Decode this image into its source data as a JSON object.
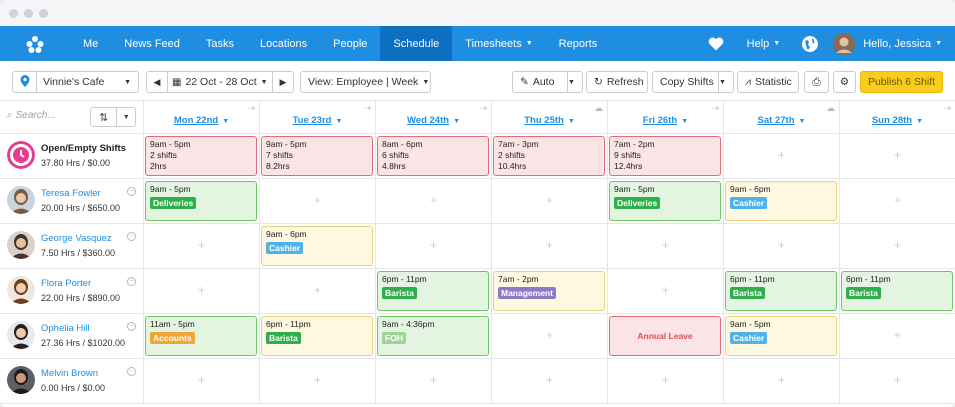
{
  "nav": {
    "items": [
      "Me",
      "News Feed",
      "Tasks",
      "Locations",
      "People",
      "Schedule",
      "Timesheets",
      "Reports"
    ],
    "active": "Schedule",
    "help": "Help",
    "greeting": "Hello, Jessica"
  },
  "toolbar": {
    "location": "Vinnie's Cafe",
    "date_range": "22 Oct - 28 Oct",
    "view": "View: Employee | Week",
    "auto": "Auto",
    "refresh": "Refresh",
    "copy_shifts": "Copy Shifts",
    "statistic": "Statistic",
    "publish": "Publish 6 Shift"
  },
  "grid": {
    "search_placeholder": "Search...",
    "days": [
      "Mon 22nd",
      "Tue 23rd",
      "Wed 24th",
      "Thu 25th",
      "Fri 26th",
      "Sat 27th",
      "Sun 28th"
    ],
    "rows": [
      {
        "name": "Open/Empty Shifts",
        "hours": "37.80 Hrs / $0.00",
        "cells": [
          {
            "lines": [
              "9am - 5pm",
              "2 shifts",
              "2hrs"
            ],
            "color": "red"
          },
          {
            "lines": [
              "9am - 5pm",
              "7 shifts",
              "8.2hrs"
            ],
            "color": "red"
          },
          {
            "lines": [
              "8am - 6pm",
              "6 shifts",
              "4.8hrs"
            ],
            "color": "red"
          },
          {
            "lines": [
              "7am - 3pm",
              "2 shifts",
              "10.4hrs"
            ],
            "color": "red"
          },
          {
            "lines": [
              "7am - 2pm",
              "9 shifts",
              "12.4hrs"
            ],
            "color": "red"
          },
          null,
          null
        ]
      },
      {
        "name": "Teresa Fowler",
        "hours": "20.00 Hrs / $650.00",
        "cells": [
          {
            "lines": [
              "9am - 5pm"
            ],
            "tag": "Deliveries",
            "tag_color": "#2eaf4a",
            "color": "green"
          },
          null,
          null,
          null,
          {
            "lines": [
              "9am - 5pm"
            ],
            "tag": "Deliveries",
            "tag_color": "#2eaf4a",
            "color": "green"
          },
          {
            "lines": [
              "9am - 6pm"
            ],
            "tag": "Cashier",
            "tag_color": "#4fb3e8",
            "color": "yellow"
          },
          null
        ]
      },
      {
        "name": "George Vasquez",
        "hours": "7.50 Hrs / $360.00",
        "cells": [
          null,
          {
            "lines": [
              "9am - 6pm"
            ],
            "tag": "Cashier",
            "tag_color": "#4fb3e8",
            "color": "yellow"
          },
          null,
          null,
          null,
          null,
          null
        ]
      },
      {
        "name": "Flora Porter",
        "hours": "22.00 Hrs / $890.00",
        "cells": [
          null,
          null,
          {
            "lines": [
              "6pm - 11pm"
            ],
            "tag": "Barista",
            "tag_color": "#2eaf4a",
            "color": "green"
          },
          {
            "lines": [
              "7am - 2pm"
            ],
            "tag": "Management",
            "tag_color": "#8c7bc6",
            "color": "yellow"
          },
          null,
          {
            "lines": [
              "6pm - 11pm"
            ],
            "tag": "Barista",
            "tag_color": "#2eaf4a",
            "color": "green"
          },
          {
            "lines": [
              "6pm - 11pm"
            ],
            "tag": "Barista",
            "tag_color": "#2eaf4a",
            "color": "green"
          }
        ]
      },
      {
        "name": "Ophelia Hill",
        "hours": "27.36 Hrs / $1020.00",
        "cells": [
          {
            "lines": [
              "11am - 5pm"
            ],
            "tag": "Accounts",
            "tag_color": "#f3a533",
            "color": "green"
          },
          {
            "lines": [
              "6pm - 11pm"
            ],
            "tag": "Barista",
            "tag_color": "#2eaf4a",
            "color": "yellow"
          },
          {
            "lines": [
              "9am - 4:36pm"
            ],
            "tag": "FOH",
            "tag_color": "#9fd39a",
            "color": "green"
          },
          null,
          {
            "leave": "Annual Leave"
          },
          {
            "lines": [
              "9am - 5pm"
            ],
            "tag": "Cashier",
            "tag_color": "#4fb3e8",
            "color": "yellow"
          },
          null
        ]
      },
      {
        "name": "Melvin Brown",
        "hours": "0.00 Hrs / $0.00",
        "cells": [
          null,
          null,
          null,
          null,
          null,
          null,
          null
        ]
      }
    ]
  }
}
